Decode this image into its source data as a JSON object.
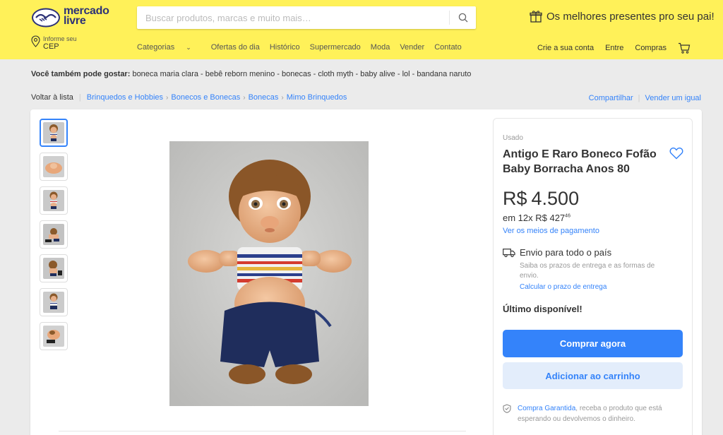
{
  "header": {
    "logo_line1": "mercado",
    "logo_line2": "livre",
    "search_placeholder": "Buscar produtos, marcas e muito mais…",
    "promo": "Os melhores presentes pro seu pai!",
    "cep_small": "Informe seu",
    "cep_big": "CEP",
    "nav": [
      "Categorias",
      "Ofertas do dia",
      "Histórico",
      "Supermercado",
      "Moda",
      "Vender",
      "Contato"
    ],
    "account": [
      "Crie a sua conta",
      "Entre",
      "Compras"
    ]
  },
  "suggest": {
    "label": "Você também pode gostar:",
    "items": " boneca maria clara - bebê reborn menino - bonecas - cloth myth - baby alive - lol - bandana naruto"
  },
  "breadcrumb": {
    "back": "Voltar à lista",
    "items": [
      "Brinquedos e Hobbies",
      "Bonecos e Bonecas",
      "Bonecas",
      "Mimo Brinquedos"
    ],
    "share": "Compartilhar",
    "sell": "Vender um igual"
  },
  "product": {
    "condition": "Usado",
    "title": "Antigo E Raro Boneco Fofão Baby Borracha Anos 80",
    "currency": "R$",
    "price": "4.500",
    "installments_prefix": "em 12x R$ 427",
    "installments_cents": "46",
    "payment_link": "Ver os meios de pagamento",
    "shipping_title": "Envio para todo o país",
    "shipping_desc": "Saiba os prazos de entrega e as formas de envio.",
    "shipping_link": "Calcular o prazo de entrega",
    "stock": "Último disponível!",
    "buy_button": "Comprar agora",
    "cart_button": "Adicionar ao carrinho",
    "guarantee_link": "Compra Garantida",
    "guarantee_text": ", receba o produto que está esperando ou devolvemos o dinheiro."
  },
  "colors": {
    "header_bg": "#fff159",
    "accent": "#3483fa",
    "accent_light": "#e3edfb"
  }
}
